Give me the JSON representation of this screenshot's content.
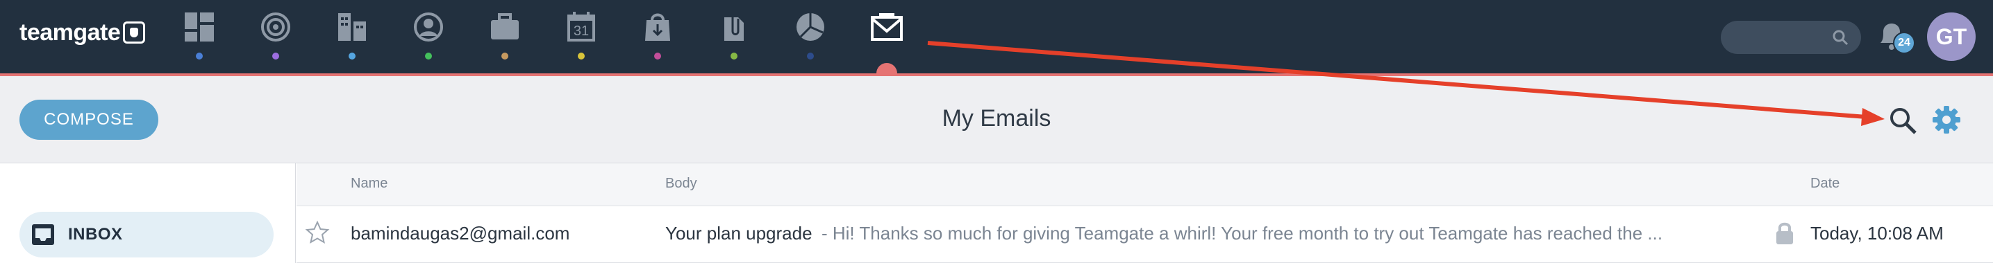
{
  "app": {
    "logo_text": "teamgate"
  },
  "nav": {
    "items": [
      {
        "name": "dashboard",
        "icon": "dashboard-icon",
        "dot_color": "#4a7fd6"
      },
      {
        "name": "targets",
        "icon": "target-icon",
        "dot_color": "#9d6ee0"
      },
      {
        "name": "companies",
        "icon": "buildings-icon",
        "dot_color": "#55a5e0"
      },
      {
        "name": "contacts",
        "icon": "contact-icon",
        "dot_color": "#44c05c"
      },
      {
        "name": "deals",
        "icon": "briefcase-icon",
        "dot_color": "#c79a60"
      },
      {
        "name": "calendar",
        "icon": "calendar-icon",
        "dot_color": "#d8c43a",
        "text": "31"
      },
      {
        "name": "sales",
        "icon": "shopping-bag-icon",
        "dot_color": "#c34e9a"
      },
      {
        "name": "documents",
        "icon": "paperclip-icon",
        "dot_color": "#86b845"
      },
      {
        "name": "reports",
        "icon": "pie-chart-icon",
        "dot_color": "#2d4c8c"
      },
      {
        "name": "emails",
        "icon": "envelope-icon",
        "active": true
      }
    ],
    "accent_color": "#e57373"
  },
  "header": {
    "notification_count": "24",
    "avatar_initials": "GT"
  },
  "subheader": {
    "compose_label": "COMPOSE",
    "title": "My Emails"
  },
  "sidebar": {
    "inbox_label": "INBOX"
  },
  "table": {
    "columns": {
      "name": "Name",
      "body": "Body",
      "date": "Date"
    },
    "rows": [
      {
        "name": "bamindaugas2@gmail.com",
        "subject": "Your plan upgrade",
        "snippet": "- Hi! Thanks so much for giving Teamgate a whirl! Your free month to try out Teamgate has reached the ...",
        "date": "Today, 10:08 AM"
      }
    ]
  },
  "colors": {
    "topbar": "#22303f",
    "compose": "#5da4ce",
    "annotation_arrow": "#e5402a"
  }
}
